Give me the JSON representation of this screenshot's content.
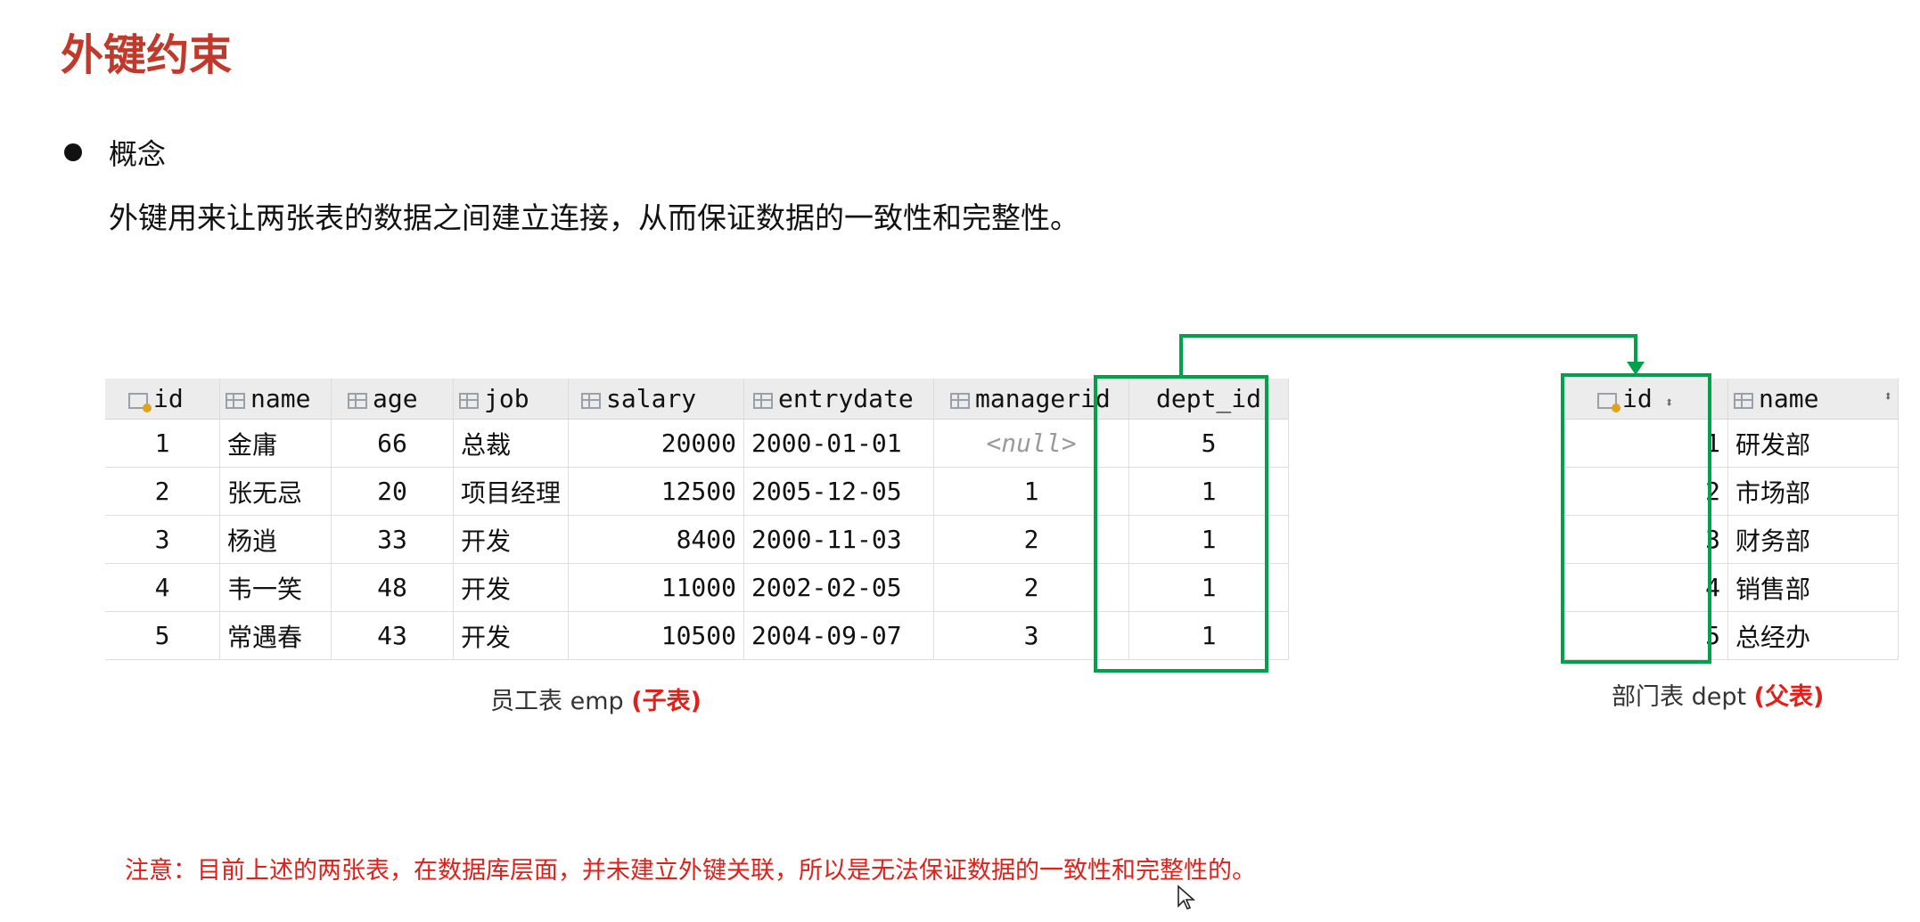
{
  "title": "外键约束",
  "bullet": "概念",
  "concept": "外键用来让两张表的数据之间建立连接，从而保证数据的一致性和完整性。",
  "emp_table": {
    "columns": [
      "id",
      "name",
      "age",
      "job",
      "salary",
      "entrydate",
      "managerid",
      "dept_id"
    ],
    "rows": [
      [
        "1",
        "金庸",
        "66",
        "总裁",
        "20000",
        "2000-01-01",
        "<null>",
        "5"
      ],
      [
        "2",
        "张无忌",
        "20",
        "项目经理",
        "12500",
        "2005-12-05",
        "1",
        "1"
      ],
      [
        "3",
        "杨逍",
        "33",
        "开发",
        "8400",
        "2000-11-03",
        "2",
        "1"
      ],
      [
        "4",
        "韦一笑",
        "48",
        "开发",
        "11000",
        "2002-02-05",
        "2",
        "1"
      ],
      [
        "5",
        "常遇春",
        "43",
        "开发",
        "10500",
        "2004-09-07",
        "3",
        "1"
      ]
    ],
    "caption": "员工表 emp",
    "caption_tag": "(子表)"
  },
  "dept_table": {
    "columns": [
      "id",
      "name"
    ],
    "rows": [
      [
        "1",
        "研发部"
      ],
      [
        "2",
        "市场部"
      ],
      [
        "3",
        "财务部"
      ],
      [
        "4",
        "销售部"
      ],
      [
        "5",
        "总经办"
      ]
    ],
    "caption": "部门表 dept",
    "caption_tag": "(父表)"
  },
  "note": "注意：目前上述的两张表，在数据库层面，并未建立外键关联，所以是无法保证数据的一致性和完整性的。",
  "colors": {
    "title": "#c0392b",
    "highlight": "#00a14b",
    "warning": "#e0201b"
  },
  "icons": [
    "primary-key-icon",
    "column-icon",
    "sort-icon",
    "mouse-cursor-icon"
  ]
}
